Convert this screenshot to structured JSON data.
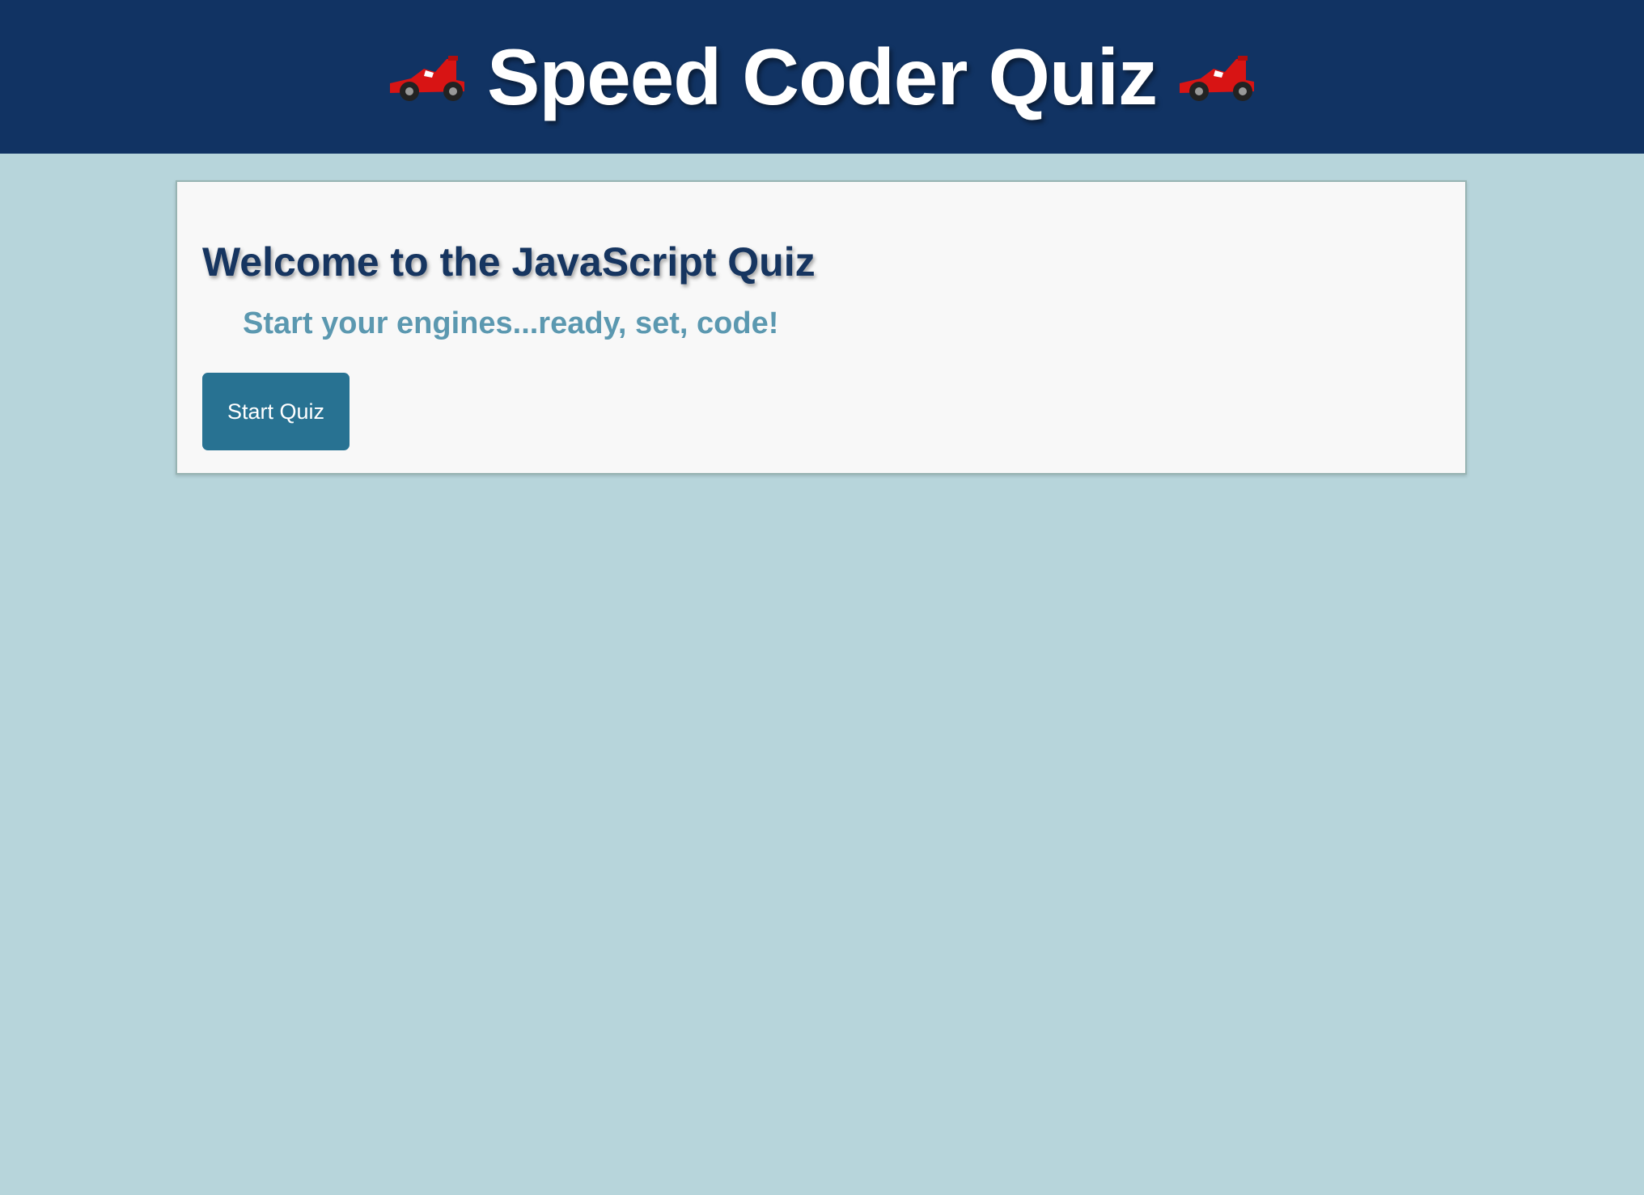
{
  "header": {
    "title": "Speed Coder Quiz",
    "left_icon": "race-car-icon",
    "right_icon": "race-car-icon",
    "background_color": "#113363"
  },
  "card": {
    "heading": "Welcome to the JavaScript Quiz",
    "tagline": "Start your engines...ready, set, code!",
    "start_button_label": "Start Quiz"
  },
  "colors": {
    "page_background": "#b7d5db",
    "heading": "#163560",
    "tagline": "#5b98b0",
    "button": "#287292"
  }
}
